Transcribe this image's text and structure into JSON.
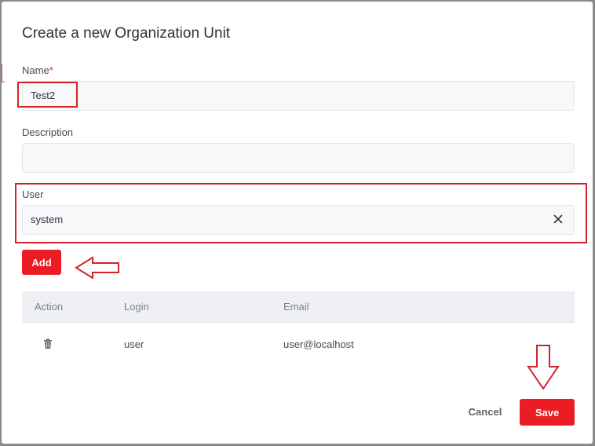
{
  "dialog": {
    "title": "Create a new Organization Unit"
  },
  "form": {
    "name": {
      "label": "Name",
      "required_mark": "*",
      "value": "Test2"
    },
    "description": {
      "label": "Description",
      "value": ""
    },
    "user": {
      "label": "User",
      "value": "system"
    }
  },
  "buttons": {
    "add": "Add",
    "cancel": "Cancel",
    "save": "Save"
  },
  "table": {
    "headers": [
      "Action",
      "Login",
      "Email"
    ],
    "rows": [
      {
        "login": "user",
        "email": "user@localhost"
      }
    ]
  },
  "icons": {
    "delete": "trash-icon",
    "clear": "close-icon"
  },
  "colors": {
    "primary": "#ea1d25",
    "annotation": "#d2232a"
  }
}
